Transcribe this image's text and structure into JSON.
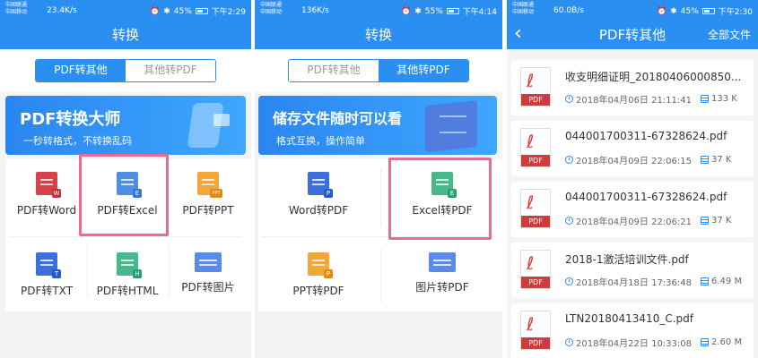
{
  "panel1": {
    "status": {
      "carrier_line1": "中国联通",
      "carrier_line2": "中国移动",
      "speed": "23.4K/s",
      "battery": "45%",
      "time": "下午2:29"
    },
    "title": "转换",
    "tabs": [
      {
        "label": "PDF转其他",
        "active": true
      },
      {
        "label": "其他转PDF",
        "active": false
      }
    ],
    "banner": {
      "title": "PDF转换大师",
      "subtitle": "一秒转格式，不转换乱码"
    },
    "items": [
      {
        "label": "PDF转Word",
        "icon": "word-icon",
        "color": "#d9404a",
        "sub": "W",
        "sub_color": "#c0313b"
      },
      {
        "label": "PDF转Excel",
        "icon": "excel-icon",
        "color": "#4f8ee6",
        "sub": "E",
        "sub_color": "#3a74cc"
      },
      {
        "label": "PDF转PPT",
        "icon": "ppt-icon",
        "color": "#f3a73a",
        "sub": "PPT",
        "sub_color": "#e08a18"
      },
      {
        "label": "PDF转TXT",
        "icon": "txt-icon",
        "color": "#3b6fe0",
        "sub": "T",
        "sub_color": "#2a59c2"
      },
      {
        "label": "PDF转HTML",
        "icon": "html-icon",
        "color": "#46b98c",
        "sub": "H",
        "sub_color": "#2f9a70"
      },
      {
        "label": "PDF转图片",
        "icon": "image-icon",
        "color": "#5b8be8",
        "sub": "",
        "sub_color": "#5b8be8"
      }
    ]
  },
  "panel2": {
    "status": {
      "carrier_line1": "中国联通",
      "carrier_line2": "中国移动",
      "speed": "136K/s",
      "battery": "55%",
      "time": "下午4:14"
    },
    "title": "转换",
    "tabs": [
      {
        "label": "PDF转其他",
        "active": false
      },
      {
        "label": "其他转PDF",
        "active": true
      }
    ],
    "banner": {
      "title": "储存文件随时可以看",
      "subtitle": "格式互换，操作简单"
    },
    "items": [
      {
        "label": "Word转PDF",
        "icon": "word-icon",
        "color": "#3b6fe0",
        "sub": "P",
        "sub_color": "#2a59c2"
      },
      {
        "label": "Excel转PDF",
        "icon": "excel-icon",
        "color": "#46b98c",
        "sub": "E",
        "sub_color": "#2f9a70"
      },
      {
        "label": "PPT转PDF",
        "icon": "ppt-icon",
        "color": "#f3a73a",
        "sub": "P",
        "sub_color": "#e08a18"
      },
      {
        "label": "图片转PDF",
        "icon": "image-icon",
        "color": "#5b8be8",
        "sub": "",
        "sub_color": "#5b8be8"
      }
    ]
  },
  "panel3": {
    "status": {
      "carrier_line1": "中国联通",
      "carrier_line2": "中国移动",
      "speed": "60.0B/s",
      "battery": "45%",
      "time": "下午2:30"
    },
    "title": "PDF转其他",
    "all_files": "全部文件",
    "files": [
      {
        "name": "收支明细证明_20180406000850...",
        "date": "2018年04月06日 21:11:41",
        "size": "133 K"
      },
      {
        "name": "044001700311-67328624.pdf",
        "date": "2018年04月09日 22:06:15",
        "size": "37 K"
      },
      {
        "name": "044001700311-67328624.pdf",
        "date": "2018年04月09日 22:06:21",
        "size": "37 K"
      },
      {
        "name": "2018-1激活培训文件.pdf",
        "date": "2018年04月18日 17:36:48",
        "size": "6.49 M"
      },
      {
        "name": "LTN20180413410_C.pdf",
        "date": "2018年04月22日 10:33:08",
        "size": "2.60 M"
      }
    ],
    "file_badge": "PDF"
  },
  "colors": {
    "accent": "#2b8ef1",
    "highlight": "#e96b94",
    "pdf_red": "#d33a3a"
  }
}
